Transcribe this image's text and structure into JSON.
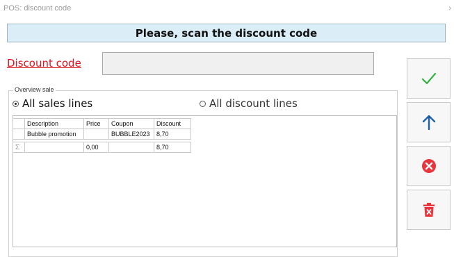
{
  "window": {
    "title": "POS: discount code",
    "close_glyph": "›"
  },
  "banner": {
    "text": "Please, scan the discount code"
  },
  "discount_code": {
    "label": "Discount code",
    "value": "",
    "placeholder": ""
  },
  "overview": {
    "legend": "Overview sale",
    "radio_all_sales": "All sales lines",
    "radio_all_discounts": "All discount lines",
    "selected": "all_sales_lines"
  },
  "grid": {
    "columns": [
      "Description",
      "Price",
      "Coupon",
      "Discount"
    ],
    "rows": [
      {
        "description": "Bubble promotion",
        "price": "",
        "coupon": "BUBBLE2023",
        "discount": "8,70"
      }
    ],
    "totals": {
      "sigma": "Σ",
      "description": "",
      "price": "0,00",
      "coupon": "",
      "discount": "8,70"
    }
  },
  "side_buttons": [
    {
      "icon": "check-icon",
      "color": "#2fb341"
    },
    {
      "icon": "arrow-up-icon",
      "color": "#1e5fa8"
    },
    {
      "icon": "cancel-circle-icon",
      "color": "#e8343a"
    },
    {
      "icon": "trash-icon",
      "color": "#e8343a"
    }
  ]
}
